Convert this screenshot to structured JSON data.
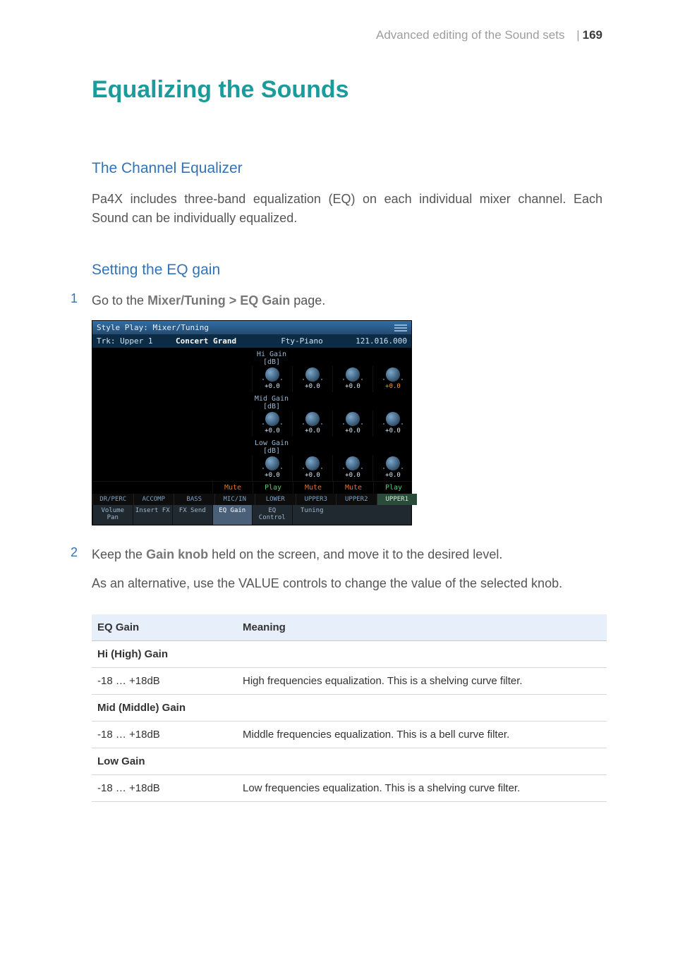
{
  "header": {
    "breadcrumb": "Advanced editing of the Sound sets",
    "separator": "|",
    "page_number": "169"
  },
  "title": "Equalizing the Sounds",
  "section1": {
    "heading": "The Channel Equalizer",
    "body": "Pa4X includes three-band equalization (EQ) on each individual mixer channel. Each Sound can be individually equalized."
  },
  "section2": {
    "heading": "Setting the EQ gain",
    "step1_num": "1",
    "step1_pre": "Go to the ",
    "step1_bold": "Mixer/Tuning > EQ Gain",
    "step1_post": " page.",
    "step2_num": "2",
    "step2_pre": "Keep the ",
    "step2_bold": "Gain knob",
    "step2_post": " held on the screen, and move it to the desired level.",
    "para_pre": "As an alternative, use the ",
    "para_caps": "VALUE",
    "para_post": " controls to change the value of the selected knob."
  },
  "screenshot": {
    "window_title": "Style Play: Mixer/Tuning",
    "trk_label": "Trk: Upper 1",
    "preset": "Concert Grand",
    "category": "Fty-Piano",
    "number": "121.016.000",
    "bands": {
      "hi": {
        "label": "Hi Gain [dB]",
        "values": [
          "+0.0",
          "+0.0",
          "+0.0",
          "+0.0"
        ],
        "selected_col": 3
      },
      "mid": {
        "label": "Mid Gain [dB]",
        "values": [
          "+0.0",
          "+0.0",
          "+0.0",
          "+0.0"
        ],
        "selected_col": -1
      },
      "low": {
        "label": "Low Gain [dB]",
        "values": [
          "+0.0",
          "+0.0",
          "+0.0",
          "+0.0"
        ],
        "selected_col": -1
      }
    },
    "states": [
      "Mute",
      "Play",
      "Mute",
      "Mute",
      "Play"
    ],
    "tracks_top": [
      "DR/PERC",
      "ACCOMP",
      "BASS",
      "MIC/IN",
      "LOWER",
      "UPPER3",
      "UPPER2",
      "UPPER1"
    ],
    "tabs_main": [
      "Volume Pan",
      "Insert FX",
      "FX Send",
      "EQ Gain",
      "EQ Control",
      "Tuning"
    ],
    "tabs_main_selected": 3
  },
  "table": {
    "head": {
      "c1": "EQ Gain",
      "c2": "Meaning"
    },
    "rows": [
      {
        "type": "section",
        "c1": "Hi (High) Gain"
      },
      {
        "type": "data",
        "c1": "-18 … +18dB",
        "c2": "High frequencies equalization. This is a shelving curve filter."
      },
      {
        "type": "section",
        "c1": "Mid (Middle) Gain"
      },
      {
        "type": "data",
        "c1": "-18 … +18dB",
        "c2": "Middle frequencies equalization. This is a bell curve filter."
      },
      {
        "type": "section",
        "c1": "Low Gain"
      },
      {
        "type": "data",
        "c1": "-18 … +18dB",
        "c2": "Low frequencies equalization. This is a shelving curve filter."
      }
    ]
  }
}
